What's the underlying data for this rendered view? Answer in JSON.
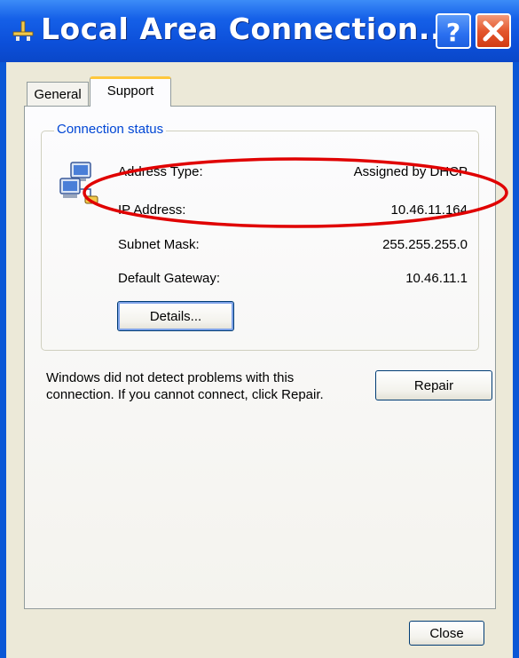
{
  "window": {
    "title": "Local Area Connection...",
    "help_glyph": "?",
    "close_glyph": "✕"
  },
  "tabs": [
    {
      "label": "General",
      "active": false
    },
    {
      "label": "Support",
      "active": true
    }
  ],
  "connection_status": {
    "group_title": "Connection status",
    "rows": [
      {
        "label": "Address Type:",
        "value": "Assigned by DHCP"
      },
      {
        "label": "IP Address:",
        "value": "10.46.11.164"
      },
      {
        "label": "Subnet Mask:",
        "value": "255.255.255.0"
      },
      {
        "label": "Default Gateway:",
        "value": "10.46.11.1"
      }
    ],
    "details_label": "Details..."
  },
  "repair_section": {
    "message": "Windows did not detect problems with this connection. If you cannot connect, click Repair.",
    "repair_label": "Repair"
  },
  "footer": {
    "close_label": "Close"
  },
  "icons": {
    "title": "network-connection-icon",
    "group": "network-computers-icon"
  },
  "colors": {
    "titlebar": "#0a57d6",
    "dialog_bg": "#ece9d8",
    "group_title": "#0046d5",
    "tab_highlight": "#ffc83c",
    "annotation": "#e00000",
    "close_button": "#e4572e"
  }
}
